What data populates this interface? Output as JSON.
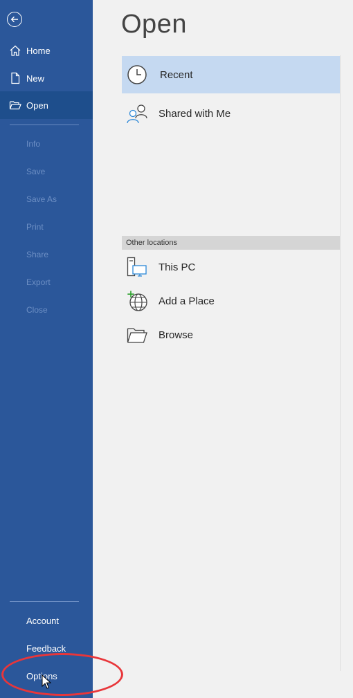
{
  "sidebar": {
    "items": [
      {
        "label": "Home"
      },
      {
        "label": "New"
      },
      {
        "label": "Open"
      },
      {
        "label": "Info"
      },
      {
        "label": "Save"
      },
      {
        "label": "Save As"
      },
      {
        "label": "Print"
      },
      {
        "label": "Share"
      },
      {
        "label": "Export"
      },
      {
        "label": "Close"
      }
    ],
    "bottom_items": [
      {
        "label": "Account"
      },
      {
        "label": "Feedback"
      },
      {
        "label": "Options"
      }
    ],
    "colors": {
      "background": "#2b579a",
      "active": "#1e4e8c",
      "disabled_text": "#6d8fc4"
    }
  },
  "main": {
    "title": "Open",
    "locations": [
      {
        "label": "Recent",
        "icon": "clock-icon"
      },
      {
        "label": "Shared with Me",
        "icon": "people-icon"
      }
    ],
    "other_header": "Other locations",
    "other_locations": [
      {
        "label": "This PC",
        "icon": "computer-icon"
      },
      {
        "label": "Add a Place",
        "icon": "globe-add-icon"
      },
      {
        "label": "Browse",
        "icon": "folder-open-icon"
      }
    ]
  }
}
